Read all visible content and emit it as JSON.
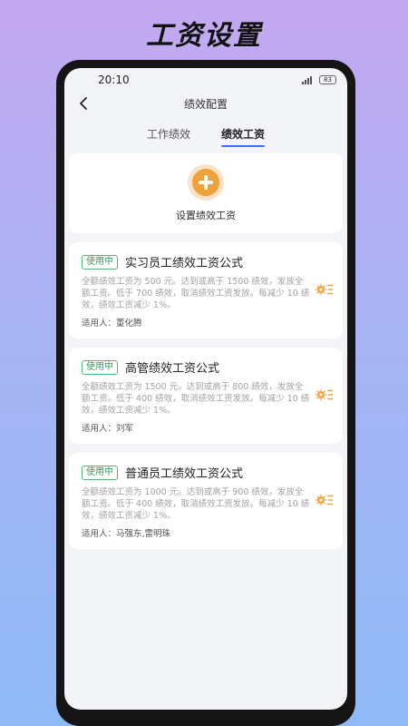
{
  "promo": {
    "title": "工资设置"
  },
  "status_bar": {
    "time": "20:10",
    "signal": "5G",
    "battery": "83"
  },
  "header": {
    "back_icon": "chevron-left-icon",
    "title": "绩效配置"
  },
  "tabs": [
    {
      "label": "工作绩效",
      "active": false
    },
    {
      "label": "绩效工资",
      "active": true
    }
  ],
  "add_card": {
    "icon": "plus-circle-icon",
    "label": "设置绩效工资"
  },
  "colors": {
    "accent": "#f0a23a",
    "badge_green": "#2f9e5a",
    "tab_underline": "#4a6cf0"
  },
  "formulas": [
    {
      "badge": "使用中",
      "title": "实习员工绩效工资公式",
      "desc": "全额绩效工资为 500 元。达到或高于 1500 绩效，发放全额工资。低于 700 绩效，取消绩效工资发放。每减少 10 绩效，绩效工资减少 1%。",
      "users_label": "适用人：",
      "users": "董化腾"
    },
    {
      "badge": "使用中",
      "title": "高管绩效工资公式",
      "desc": "全额绩效工资为 1500 元。达到或高于 800 绩效，发放全额工资。低于 400 绩效，取消绩效工资发放。每减少 10 绩效，绩效工资减少 1%。",
      "users_label": "适用人：",
      "users": "刘军"
    },
    {
      "badge": "使用中",
      "title": "普通员工绩效工资公式",
      "desc": "全额绩效工资为 1000 元。达到或高于 900 绩效，发放全额工资。低于 400 绩效，取消绩效工资发放。每减少 10 绩效，绩效工资减少 1%。",
      "users_label": "适用人：",
      "users": "马强东,雷明珠"
    }
  ]
}
